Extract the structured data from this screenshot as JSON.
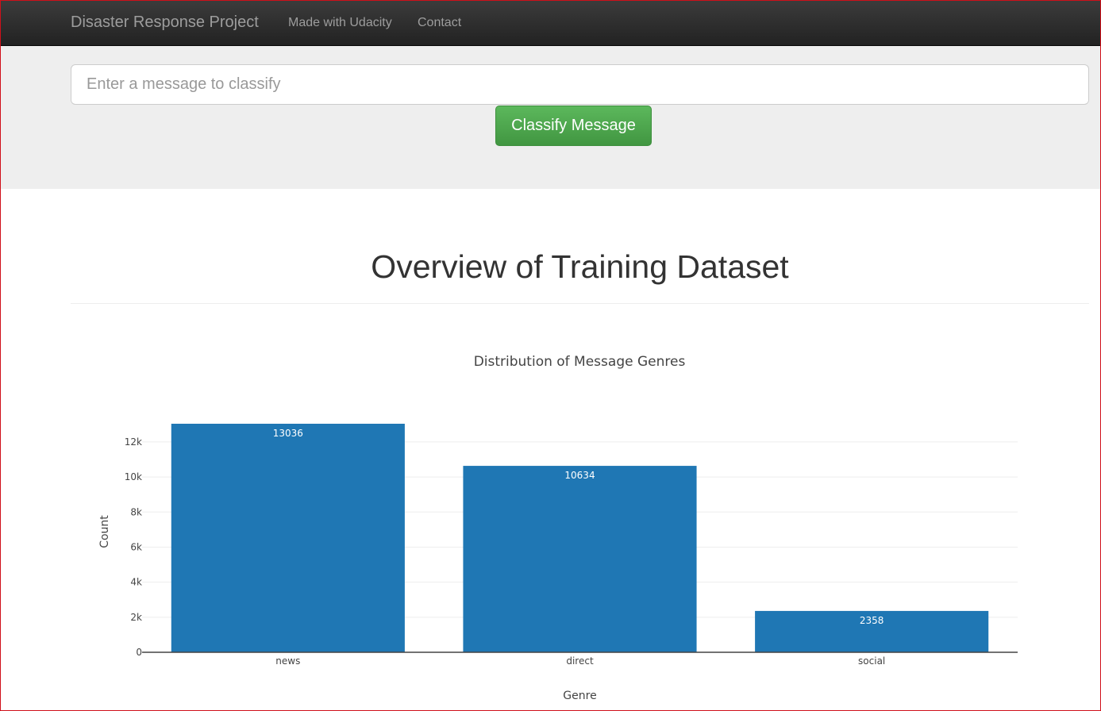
{
  "navbar": {
    "brand": "Disaster Response Project",
    "links": [
      "Made with Udacity",
      "Contact"
    ]
  },
  "search": {
    "placeholder": "Enter a message to classify",
    "value": "",
    "button_label": "Classify Message"
  },
  "main": {
    "title": "Overview of Training Dataset"
  },
  "colors": {
    "bar": "#1f77b4",
    "navbar": "#222222",
    "button": "#5cb85c"
  },
  "chart_data": {
    "type": "bar",
    "title": "Distribution of Message Genres",
    "categories": [
      "news",
      "direct",
      "social"
    ],
    "values": [
      13036,
      10634,
      2358
    ],
    "data_labels": [
      "13036",
      "10634",
      "2358"
    ],
    "xlabel": "Genre",
    "ylabel": "Count",
    "ylim": [
      0,
      13036
    ],
    "yticks": [
      0,
      2000,
      4000,
      6000,
      8000,
      10000,
      12000
    ],
    "ytick_labels": [
      "0",
      "2k",
      "4k",
      "6k",
      "8k",
      "10k",
      "12k"
    ],
    "grid": true,
    "legend": "none"
  }
}
